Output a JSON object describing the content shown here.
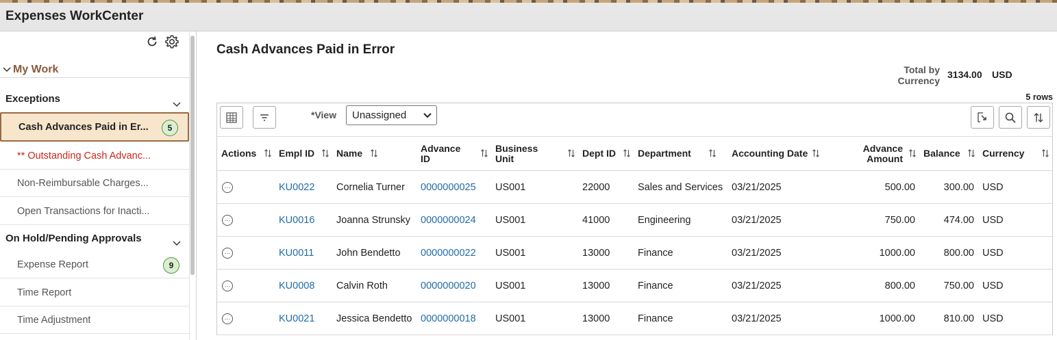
{
  "app": {
    "title": "Expenses WorkCenter"
  },
  "left": {
    "my_work": "My Work",
    "sections": [
      {
        "title": "Exceptions",
        "items": [
          {
            "label": "Cash Advances Paid in Er...",
            "count": "5"
          },
          {
            "label": "** Outstanding Cash Advanc..."
          },
          {
            "label": "Non-Reimbursable Charges..."
          },
          {
            "label": "Open Transactions for Inacti..."
          }
        ]
      },
      {
        "title": "On Hold/Pending Approvals",
        "items": [
          {
            "label": "Expense Report",
            "count": "9"
          },
          {
            "label": "Time Report"
          },
          {
            "label": "Time Adjustment"
          }
        ]
      }
    ]
  },
  "main": {
    "title": "Cash Advances Paid in Error",
    "total_label": "Total by Currency",
    "total_value": "3134.00",
    "total_currency": "USD",
    "row_count": "5 rows",
    "view_label": "*View",
    "view_value": "Unassigned",
    "columns": [
      "Actions",
      "Empl ID",
      "Name",
      "Advance ID",
      "Business Unit",
      "Dept ID",
      "Department",
      "Accounting Date",
      "Advance Amount",
      "Balance",
      "Currency"
    ],
    "rows": [
      {
        "empl_id": "KU0022",
        "name": "Cornelia Turner",
        "advance_id": "0000000025",
        "bu": "US001",
        "dept_id": "22000",
        "department": "Sales and Services",
        "date": "03/21/2025",
        "amount": "500.00",
        "balance": "300.00",
        "currency": "USD"
      },
      {
        "empl_id": "KU0016",
        "name": "Joanna Strunsky",
        "advance_id": "0000000024",
        "bu": "US001",
        "dept_id": "41000",
        "department": "Engineering",
        "date": "03/21/2025",
        "amount": "750.00",
        "balance": "474.00",
        "currency": "USD"
      },
      {
        "empl_id": "KU0011",
        "name": "John Bendetto",
        "advance_id": "0000000022",
        "bu": "US001",
        "dept_id": "13000",
        "department": "Finance",
        "date": "03/21/2025",
        "amount": "1000.00",
        "balance": "800.00",
        "currency": "USD"
      },
      {
        "empl_id": "KU0008",
        "name": "Calvin Roth",
        "advance_id": "0000000020",
        "bu": "US001",
        "dept_id": "13000",
        "department": "Finance",
        "date": "03/21/2025",
        "amount": "800.00",
        "balance": "750.00",
        "currency": "USD"
      },
      {
        "empl_id": "KU0021",
        "name": "Jessica Bendetto",
        "advance_id": "0000000018",
        "bu": "US001",
        "dept_id": "13000",
        "department": "Finance",
        "date": "03/21/2025",
        "amount": "1000.00",
        "balance": "810.00",
        "currency": "USD"
      }
    ]
  },
  "colors": {
    "accent": "#8a5a3b",
    "link": "#1f6ba6",
    "active_bg": "#f8e6cc",
    "error": "#c8261b"
  }
}
